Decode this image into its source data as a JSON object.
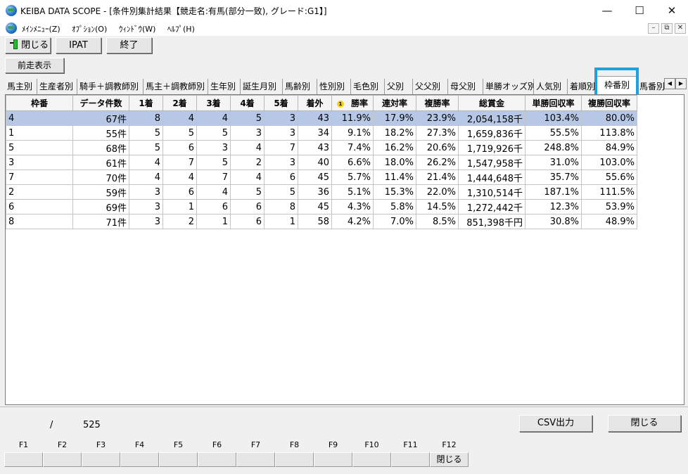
{
  "window": {
    "title": "KEIBA DATA SCOPE - [条件別集計結果【競走名:有馬(部分一致), グレード:G1】]",
    "minimize": "—",
    "maximize": "☐",
    "close": "✕"
  },
  "menu": {
    "main": "ﾒｲﾝﾒﾆｭｰ(Z)",
    "options": "ｵﾌﾟｼｮﾝ(O)",
    "window": "ｳｨﾝﾄﾞｳ(W)",
    "help": "ﾍﾙﾌﾟ(H)",
    "mdi_minimize": "–",
    "mdi_restore": "⧉",
    "mdi_close": "✕"
  },
  "toolbar": {
    "close_label": "閉じる",
    "ipat_label": "IPAT",
    "exit_label": "終了",
    "prev_race_label": "前走表示"
  },
  "tabs": [
    "馬主別",
    "生産者別",
    "騎手＋調教師別",
    "馬主＋調教師別",
    "生年別",
    "誕生月別",
    "馬齢別",
    "性別別",
    "毛色別",
    "父別",
    "父父別",
    "母父別",
    "単勝オッズ別",
    "人気別",
    "着順別",
    "枠番別",
    "馬番別"
  ],
  "active_tab": "枠番別",
  "tab_scroll": {
    "left": "◀",
    "right": "▶"
  },
  "table": {
    "sort_badge": "1",
    "headers": [
      "枠番",
      "データ件数",
      "1着",
      "2着",
      "3着",
      "4着",
      "5着",
      "着外",
      "勝率",
      "連対率",
      "複勝率",
      "総賞金",
      "単勝回収率",
      "複勝回収率"
    ],
    "rows": [
      [
        "4",
        "67件",
        "8",
        "4",
        "4",
        "5",
        "3",
        "43",
        "11.9%",
        "17.9%",
        "23.9%",
        "2,054,158千",
        "103.4%",
        "80.0%"
      ],
      [
        "1",
        "55件",
        "5",
        "5",
        "5",
        "3",
        "3",
        "34",
        "9.1%",
        "18.2%",
        "27.3%",
        "1,659,836千",
        "55.5%",
        "113.8%"
      ],
      [
        "5",
        "68件",
        "5",
        "6",
        "3",
        "4",
        "7",
        "43",
        "7.4%",
        "16.2%",
        "20.6%",
        "1,719,926千",
        "248.8%",
        "84.9%"
      ],
      [
        "3",
        "61件",
        "4",
        "7",
        "5",
        "2",
        "3",
        "40",
        "6.6%",
        "18.0%",
        "26.2%",
        "1,547,958千",
        "31.0%",
        "103.0%"
      ],
      [
        "7",
        "70件",
        "4",
        "4",
        "7",
        "4",
        "6",
        "45",
        "5.7%",
        "11.4%",
        "21.4%",
        "1,444,648千",
        "35.7%",
        "55.6%"
      ],
      [
        "2",
        "59件",
        "3",
        "6",
        "4",
        "5",
        "5",
        "36",
        "5.1%",
        "15.3%",
        "22.0%",
        "1,310,514千",
        "187.1%",
        "111.5%"
      ],
      [
        "6",
        "69件",
        "3",
        "1",
        "6",
        "6",
        "8",
        "45",
        "4.3%",
        "5.8%",
        "14.5%",
        "1,272,442千",
        "12.3%",
        "53.9%"
      ],
      [
        "8",
        "71件",
        "3",
        "2",
        "1",
        "6",
        "1",
        "58",
        "4.2%",
        "7.0%",
        "8.5%",
        "851,398千円",
        "30.8%",
        "48.9%"
      ]
    ]
  },
  "status": {
    "separator": "/",
    "total": "525",
    "csv_label": "CSV出力",
    "close_label": "閉じる"
  },
  "fkeys": {
    "labels": [
      "F1",
      "F2",
      "F3",
      "F4",
      "F5",
      "F6",
      "F7",
      "F8",
      "F9",
      "F10",
      "F11",
      "F12"
    ],
    "values": [
      "",
      "",
      "",
      "",
      "",
      "",
      "",
      "",
      "",
      "",
      "",
      "閉じる"
    ]
  }
}
